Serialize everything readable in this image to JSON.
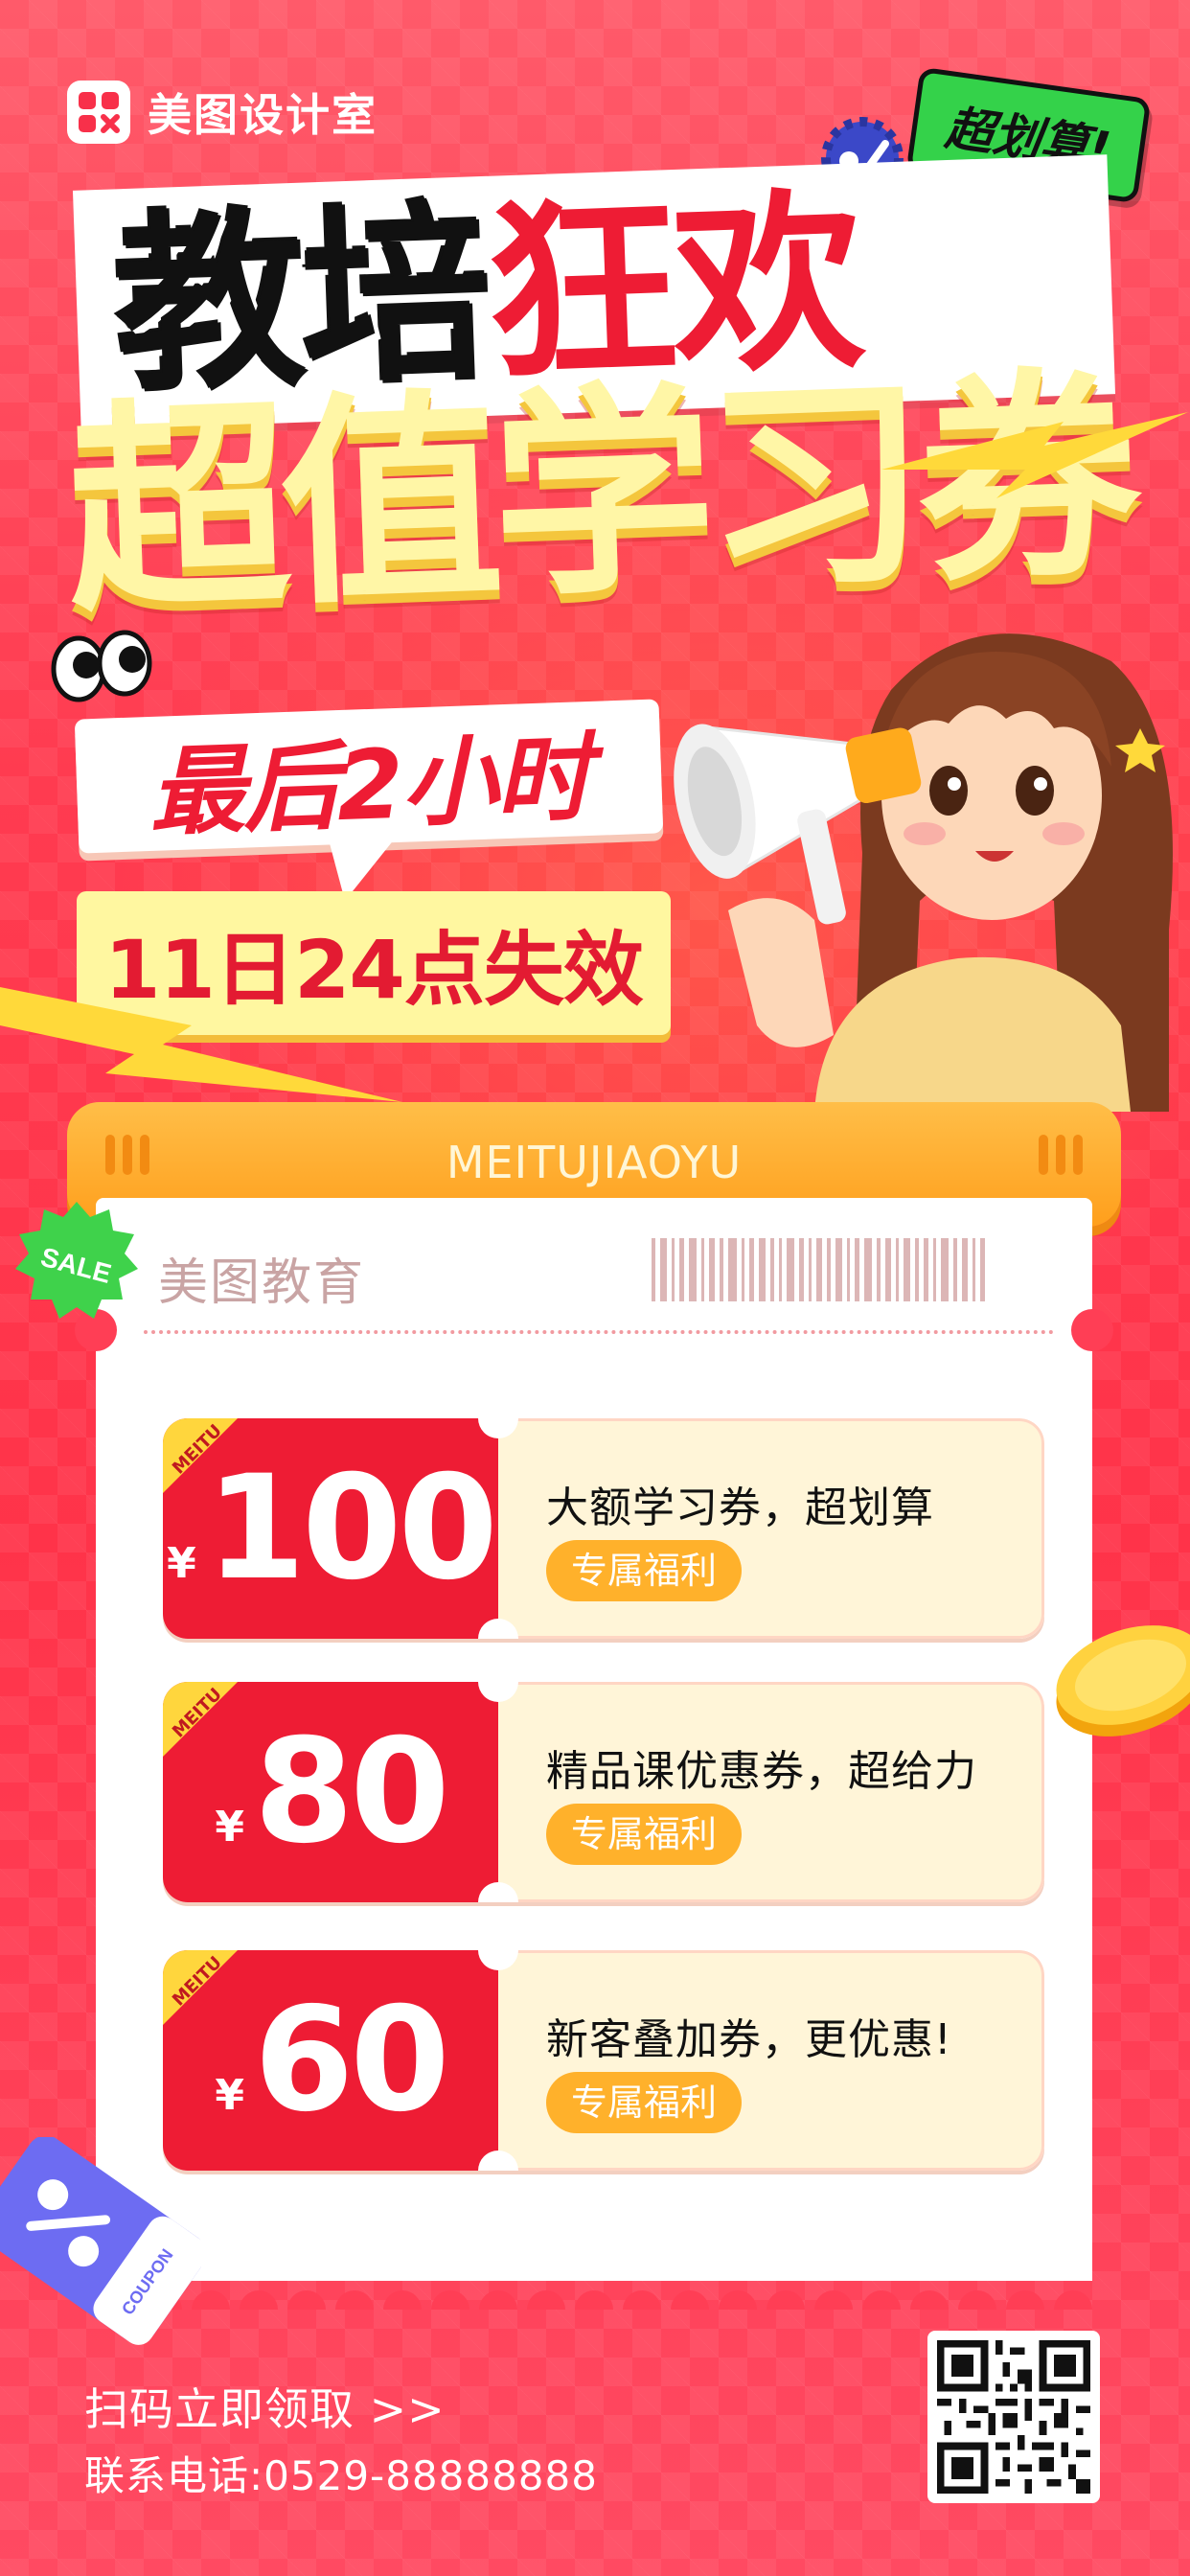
{
  "brand": {
    "name": "美图设计室",
    "logo_icon": "meitu-logo-icon"
  },
  "sticker": {
    "label": "超划算!"
  },
  "headline": {
    "part1": "教培",
    "part2": "狂欢",
    "line2": "超值学习券",
    "last_hours": "最后2小时",
    "expiry": "11日24点失效"
  },
  "ticket": {
    "header_label": "MEITUJIAOYU",
    "title": "美图教育",
    "sale_badge": "SALE"
  },
  "coupons": [
    {
      "currency": "¥",
      "amount": "100",
      "title": "大额学习券，超划算",
      "tag": "专属福利",
      "corner": "MEITU"
    },
    {
      "currency": "¥",
      "amount": "80",
      "title": "精品课优惠券，超给力",
      "tag": "专属福利",
      "corner": "MEITU"
    },
    {
      "currency": "¥",
      "amount": "60",
      "title": "新客叠加券，更优惠!",
      "tag": "专属福利",
      "corner": "MEITU"
    }
  ],
  "coupon_sticker": {
    "label": "COUPON"
  },
  "footer": {
    "cta": "扫码立即领取 >>",
    "phone": "联系电话:0529-88888888"
  },
  "colors": {
    "background": "#ff3b50",
    "accent_red": "#ee1c34",
    "accent_yellow": "#fff6a6",
    "accent_orange": "#ffb12b",
    "accent_green": "#34d24a"
  }
}
